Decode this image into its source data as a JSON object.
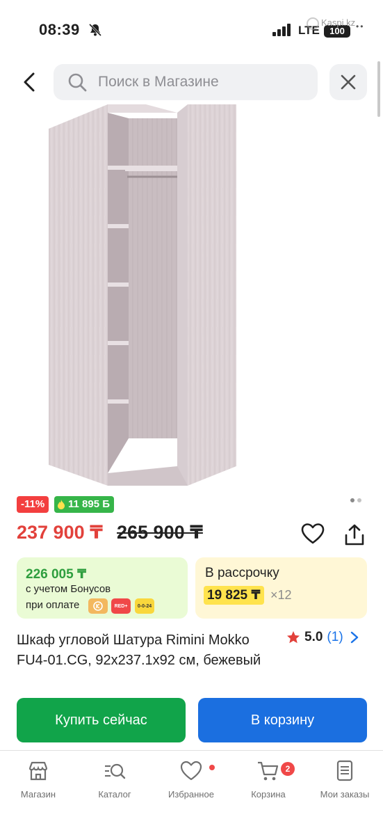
{
  "status_bar": {
    "time": "08:39",
    "network": "LTE",
    "battery": "100",
    "watermark": "Kaspi.kz"
  },
  "search": {
    "placeholder": "Поиск в Магазине"
  },
  "product": {
    "discount_badge": "-11%",
    "bonus_badge": "11 895 Б",
    "price": "237 900 ₸",
    "old_price": "265 900 ₸",
    "title": "Шкаф угловой Шатура Rimini Mokko FU4-01.CG, 92x237.1x92 см, бежевый",
    "rating": "5.0",
    "reviews": "(1)",
    "image_pages": 2,
    "image_active_page": 1
  },
  "bonus_card": {
    "amount": "226 005 ₸",
    "line1": "с учетом Бонусов",
    "line2": "при оплате",
    "icon_red": "RED+",
    "icon_024": "0-0-24"
  },
  "installment_card": {
    "title": "В рассрочку",
    "monthly": "19 825 ₸",
    "months": "×12"
  },
  "actions": {
    "buy_now": "Купить сейчас",
    "add_to_cart": "В корзину"
  },
  "tabs": [
    {
      "label": "Магазин",
      "icon": "store-icon"
    },
    {
      "label": "Каталог",
      "icon": "catalog-search-icon"
    },
    {
      "label": "Избранное",
      "icon": "heart-icon"
    },
    {
      "label": "Корзина",
      "icon": "cart-icon",
      "badge": "2"
    },
    {
      "label": "Мои заказы",
      "icon": "orders-icon"
    }
  ],
  "colors": {
    "price_red": "#e2413b",
    "buy_green": "#11a44a",
    "cart_blue": "#1b6fe0",
    "bonus_green": "#36b549",
    "discount_red": "#f33f3f"
  }
}
